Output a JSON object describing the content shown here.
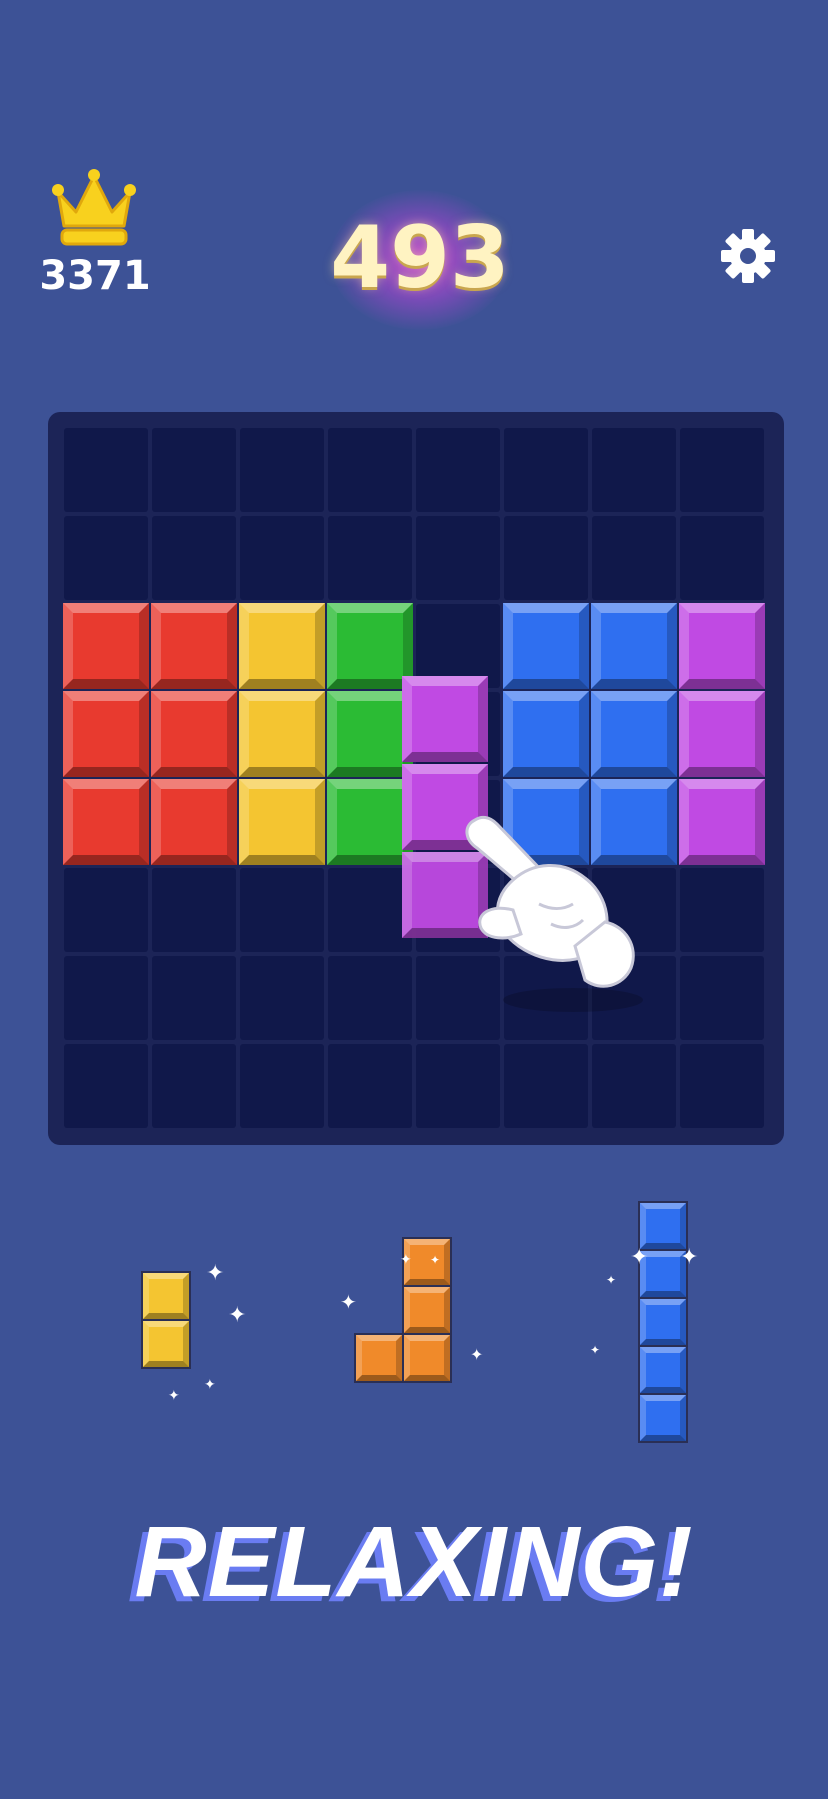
{
  "header": {
    "best_score": "3371",
    "current_score": "493",
    "best_icon": "crown-icon",
    "settings_icon": "gear-icon"
  },
  "colors": {
    "background": "#3d5296",
    "board": "#1c2457",
    "empty_cell": "#10184a",
    "red": "#e83a2f",
    "yellow": "#f4c531",
    "green": "#2bbb34",
    "blue": "#2f6ff0",
    "purple": "#c04ae3",
    "orange": "#f08a2a"
  },
  "board": {
    "rows": 8,
    "cols": 8,
    "cells": [
      [
        ".",
        ".",
        ".",
        ".",
        ".",
        ".",
        ".",
        "."
      ],
      [
        ".",
        ".",
        ".",
        ".",
        ".",
        ".",
        ".",
        "."
      ],
      [
        "red",
        "red",
        "yellow",
        "green",
        ".",
        "blue",
        "blue",
        "purple"
      ],
      [
        "red",
        "red",
        "yellow",
        "green",
        ".",
        "blue",
        "blue",
        "purple"
      ],
      [
        "red",
        "red",
        "yellow",
        "green",
        ".",
        "blue",
        "blue",
        "purple"
      ],
      [
        ".",
        ".",
        ".",
        ".",
        ".",
        ".",
        ".",
        "."
      ],
      [
        ".",
        ".",
        ".",
        ".",
        ".",
        ".",
        ".",
        "."
      ],
      [
        ".",
        ".",
        ".",
        ".",
        ".",
        ".",
        ".",
        "."
      ]
    ],
    "dragging_piece": {
      "color": "purple",
      "shape": "I3-vertical"
    }
  },
  "tray": [
    {
      "color": "yellow",
      "shape": "I2-vertical"
    },
    {
      "color": "orange",
      "shape": "J"
    },
    {
      "color": "blue",
      "shape": "I5-vertical"
    }
  ],
  "hint_icon": "pointing-hand-icon",
  "slogan": "RELAXING!"
}
